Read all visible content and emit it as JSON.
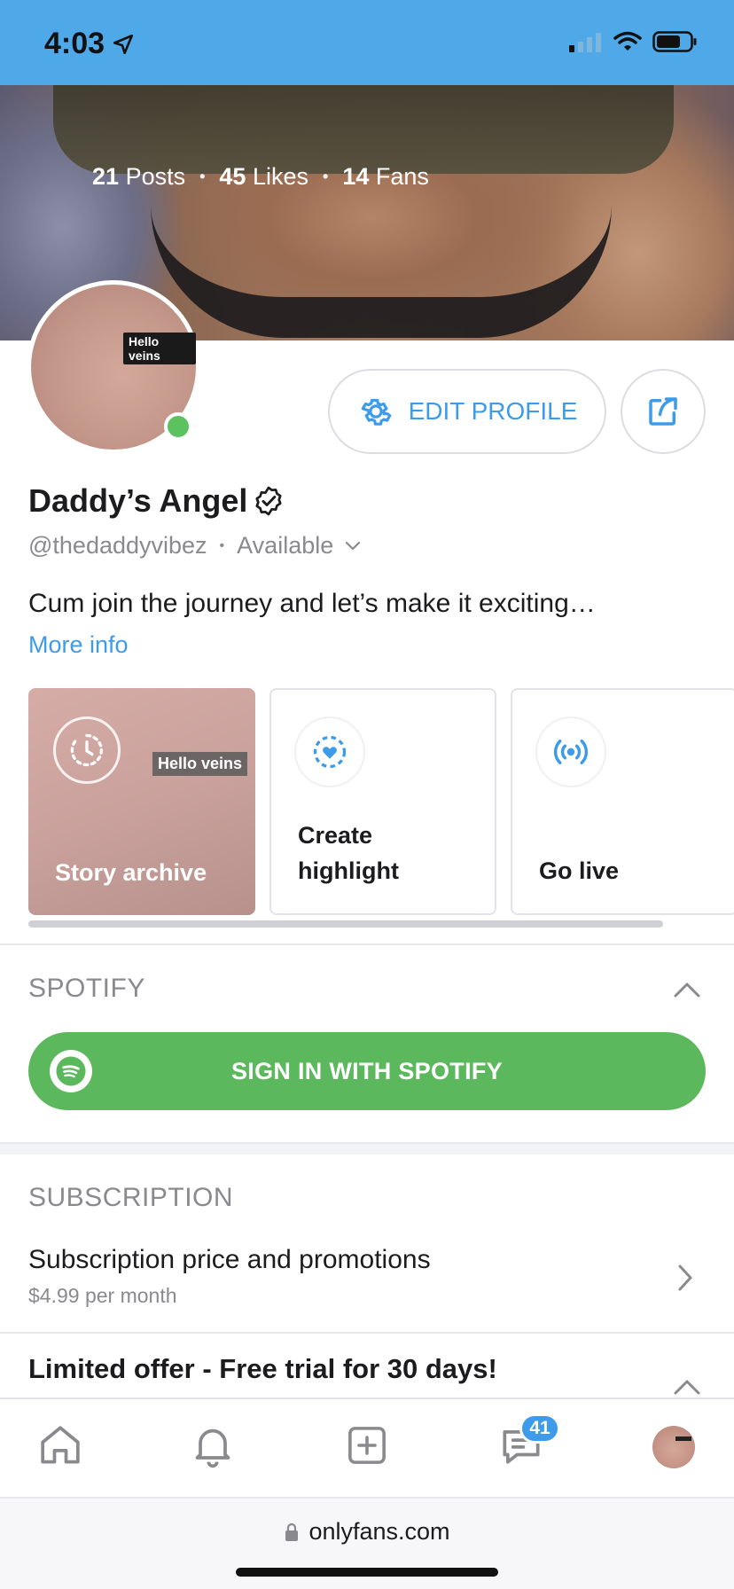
{
  "status_bar": {
    "time": "4:03"
  },
  "cover": {
    "posts_count": "21",
    "posts_label": "Posts",
    "likes_count": "45",
    "likes_label": "Likes",
    "fans_count": "14",
    "fans_label": "Fans",
    "separator": "•"
  },
  "avatar": {
    "tag": "Hello veins",
    "online": true
  },
  "actions": {
    "edit_profile": "EDIT PROFILE"
  },
  "profile": {
    "name": "Daddy’s Angel",
    "handle": "@thedaddyvibez",
    "separator": "•",
    "availability": "Available",
    "bio": "Cum join the journey and let’s make it exciting…",
    "more_info": "More info"
  },
  "cards": {
    "archive": {
      "label": "Story archive",
      "tag": "Hello veins"
    },
    "highlight": {
      "label_line1": "Create",
      "label_line2": "highlight"
    },
    "live": {
      "label": "Go live"
    }
  },
  "spotify": {
    "title": "SPOTIFY",
    "button": "SIGN IN WITH SPOTIFY"
  },
  "subscription": {
    "title": "SUBSCRIPTION",
    "row_title": "Subscription price and promotions",
    "row_price": "$4.99 per month",
    "offer": "Limited offer - Free trial for 30 days!"
  },
  "tabbar": {
    "messages_badge": "41"
  },
  "browser": {
    "url": "onlyfans.com"
  },
  "colors": {
    "accent": "#3d9be9",
    "status_bar": "#4fa9e8",
    "spotify_green": "#5cb85c",
    "online": "#5cc15f"
  }
}
